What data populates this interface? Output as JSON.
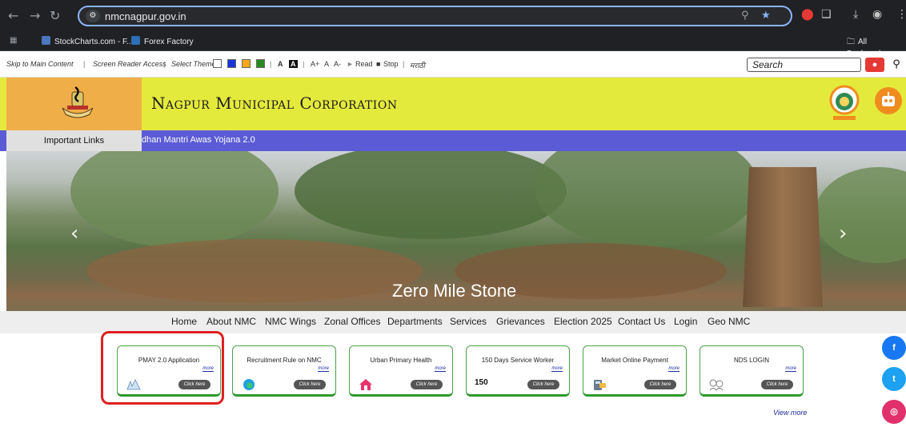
{
  "browser": {
    "url": "nmcnagpur.gov.in",
    "icons": {
      "back": "←",
      "forward": "→",
      "reload": "↻"
    },
    "bookmarks": [
      {
        "label": "StockCharts.com - F...",
        "color": "#4b77be"
      },
      {
        "label": "Forex Factory",
        "color": "#2d6fb7"
      }
    ],
    "all_bookmarks": "All Bookmarks"
  },
  "accessibility": {
    "skip": "Skip to Main Content",
    "reader": "Screen Reader Access",
    "theme": "Select Theme",
    "a1": "A",
    "a2": "A",
    "aplus": "A+",
    "anorm": "A",
    "aminus": "A-",
    "read": "Read",
    "stop": "Stop",
    "lang": "मराठी",
    "theme_colors": [
      "#ffffff",
      "#1a36d8",
      "#f7a81b",
      "#2a8a1e"
    ],
    "search_placeholder": "Search"
  },
  "header": {
    "title": "Nagpur Municipal Corporation"
  },
  "ticker": {
    "label": "Important Links",
    "text": "dhan Mantri Awas Yojana 2.0"
  },
  "hero": {
    "caption": "Zero Mile Stone"
  },
  "nav": [
    "Home",
    "About NMC",
    "NMC Wings",
    "Zonal Offices",
    "Departments",
    "Services",
    "Grievances",
    "Election 2025",
    "Contact Us",
    "Login",
    "Geo NMC"
  ],
  "cards": [
    {
      "title": "PMAY 2.0 Application",
      "more": "more",
      "button": "Click here",
      "icon": "pmay-logo-icon"
    },
    {
      "title": "Recruitment Rule on NMC",
      "more": "more",
      "button": "Click here",
      "icon": "edge-logo-icon"
    },
    {
      "title": "Urban Primary Health",
      "more": "more",
      "button": "Click here",
      "icon": "house-icon",
      "icon_text": ""
    },
    {
      "title": "150 Days Service Worker",
      "more": "more",
      "button": "Click here",
      "icon": "number-150-icon",
      "icon_text": "150"
    },
    {
      "title": "Market Online Payment",
      "more": "more",
      "button": "Click here",
      "icon": "payment-terminal-icon"
    },
    {
      "title": "NDS LOGIN",
      "more": "more",
      "button": "Click here",
      "icon": "people-sketch-icon"
    }
  ],
  "view_more": "View more",
  "social": [
    {
      "name": "facebook-icon",
      "glyph": "f",
      "color": "#1877f2"
    },
    {
      "name": "twitter-icon",
      "glyph": "t",
      "color": "#1da1f2"
    },
    {
      "name": "instagram-icon",
      "glyph": "◎",
      "color": "#e1306c"
    }
  ]
}
